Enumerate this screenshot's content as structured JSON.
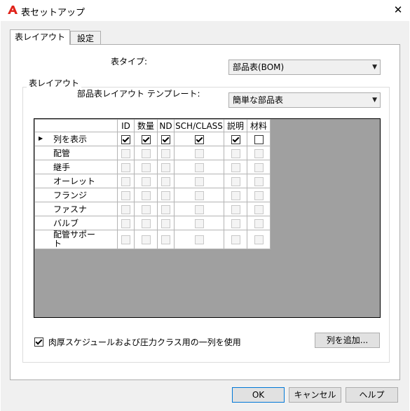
{
  "window": {
    "title": "表セットアップ",
    "close_symbol": "✕"
  },
  "tabs": [
    {
      "label": "表レイアウト"
    },
    {
      "label": "設定"
    }
  ],
  "table_type": {
    "label": "表タイプ:",
    "value": "部品表(BOM)"
  },
  "layout_group": {
    "title": "表レイアウト",
    "template_label": "部品表レイアウト テンプレート:",
    "template_value": "簡単な部品表"
  },
  "grid": {
    "columns": [
      "ID",
      "数量",
      "ND",
      "SCH/CLASS",
      "説明",
      "材料"
    ],
    "rows": [
      {
        "label": "列を表示",
        "current": true,
        "checks": [
          true,
          true,
          true,
          true,
          true,
          false
        ],
        "enabled": true
      },
      {
        "label": "配管",
        "checks": [
          false,
          false,
          false,
          false,
          false,
          false
        ],
        "enabled": false
      },
      {
        "label": "継手",
        "checks": [
          false,
          false,
          false,
          false,
          false,
          false
        ],
        "enabled": false
      },
      {
        "label": "オーレット",
        "checks": [
          false,
          false,
          false,
          false,
          false,
          false
        ],
        "enabled": false
      },
      {
        "label": "フランジ",
        "checks": [
          false,
          false,
          false,
          false,
          false,
          false
        ],
        "enabled": false
      },
      {
        "label": "ファスナ",
        "checks": [
          false,
          false,
          false,
          false,
          false,
          false
        ],
        "enabled": false
      },
      {
        "label": "バルブ",
        "checks": [
          false,
          false,
          false,
          false,
          false,
          false
        ],
        "enabled": false
      },
      {
        "label": "配管サポート",
        "checks": [
          false,
          false,
          false,
          false,
          false,
          false
        ],
        "enabled": false
      }
    ]
  },
  "wall_thickness": {
    "label": "肉厚スケジュールおよび圧力クラス用の一列を使用",
    "checked": true
  },
  "add_column_label": "列を追加...",
  "buttons": {
    "ok": "OK",
    "cancel": "キャンセル",
    "help": "ヘルプ"
  },
  "colors": {
    "app_icon": "#e0241b",
    "grid_bg": "#a0a0a0",
    "default_button_border": "#0078d7"
  }
}
